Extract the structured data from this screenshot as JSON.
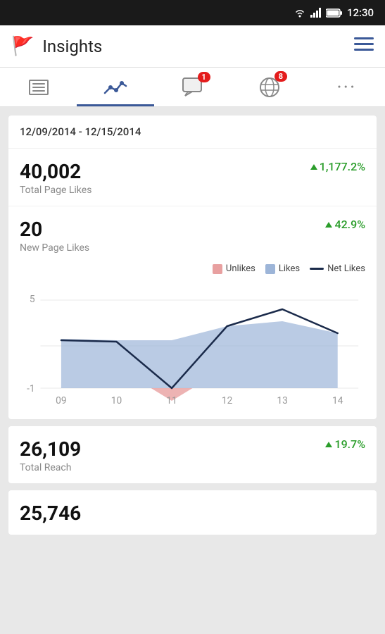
{
  "statusBar": {
    "time": "12:30",
    "icons": [
      "wifi",
      "signal",
      "battery"
    ]
  },
  "header": {
    "title": "Insights",
    "flagIcon": "🚩",
    "menuIcon": "≡"
  },
  "tabs": [
    {
      "id": "list",
      "label": "List",
      "active": false,
      "badge": null
    },
    {
      "id": "chart",
      "label": "Chart",
      "active": true,
      "badge": null
    },
    {
      "id": "messages",
      "label": "Messages",
      "active": false,
      "badge": "1"
    },
    {
      "id": "globe",
      "label": "Globe",
      "active": false,
      "badge": "8"
    },
    {
      "id": "more",
      "label": "More",
      "active": false,
      "badge": null
    }
  ],
  "dateRange": "12/09/2014 - 12/15/2014",
  "metrics": {
    "totalPageLikes": {
      "value": "40,002",
      "label": "Total Page Likes",
      "change": "1,177.2%",
      "changePositive": true
    },
    "newPageLikes": {
      "value": "20",
      "label": "New Page Likes",
      "change": "42.9%",
      "changePositive": true
    },
    "totalReach": {
      "value": "26,109",
      "label": "Total Reach",
      "change": "19.7%",
      "changePositive": true
    },
    "nextMetric": {
      "value": "25,746",
      "label": ""
    }
  },
  "chart": {
    "legend": {
      "unlikes": "Unlikes",
      "likes": "Likes",
      "netLikes": "Net Likes"
    },
    "xLabels": [
      "09",
      "10",
      "11",
      "12",
      "13",
      "14"
    ],
    "yLabels": [
      "5",
      "-1"
    ],
    "colors": {
      "likes": "#9db5d8",
      "unlikes": "#e8a0a0",
      "netLikes": "#1a2a4a"
    }
  }
}
